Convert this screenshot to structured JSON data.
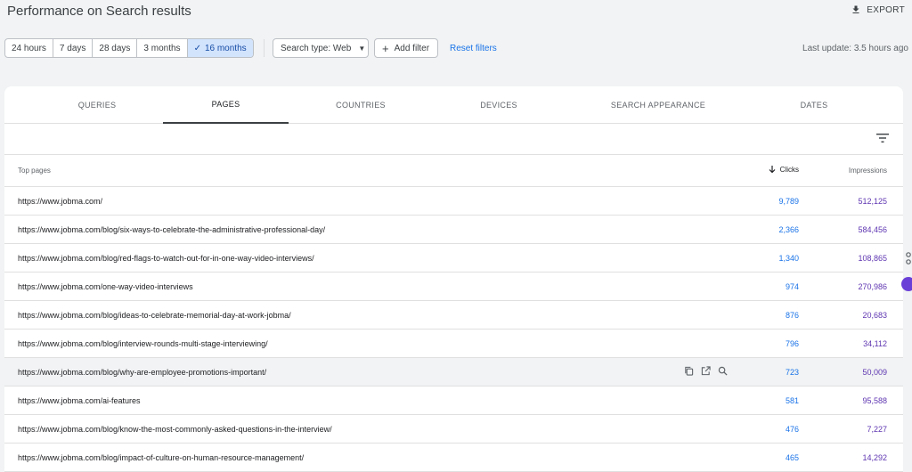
{
  "header": {
    "title": "Performance on Search results",
    "export_label": "EXPORT"
  },
  "date_ranges": [
    {
      "label": "24 hours",
      "active": false
    },
    {
      "label": "7 days",
      "active": false
    },
    {
      "label": "28 days",
      "active": false
    },
    {
      "label": "3 months",
      "active": false
    },
    {
      "label": "16 months",
      "active": true
    }
  ],
  "filters": {
    "search_type_label": "Search type: Web",
    "add_filter_label": "Add filter",
    "reset_label": "Reset filters"
  },
  "last_update": "Last update: 3.5 hours ago",
  "tabs": [
    "QUERIES",
    "PAGES",
    "COUNTRIES",
    "DEVICES",
    "SEARCH APPEARANCE",
    "DATES"
  ],
  "active_tab": "PAGES",
  "table": {
    "headers": {
      "pages": "Top pages",
      "clicks": "Clicks",
      "impressions": "Impressions"
    },
    "rows": [
      {
        "url": "https://www.jobma.com/",
        "clicks": "9,789",
        "impressions": "512,125"
      },
      {
        "url": "https://www.jobma.com/blog/six-ways-to-celebrate-the-administrative-professional-day/",
        "clicks": "2,366",
        "impressions": "584,456"
      },
      {
        "url": "https://www.jobma.com/blog/red-flags-to-watch-out-for-in-one-way-video-interviews/",
        "clicks": "1,340",
        "impressions": "108,865"
      },
      {
        "url": "https://www.jobma.com/one-way-video-interviews",
        "clicks": "974",
        "impressions": "270,986"
      },
      {
        "url": "https://www.jobma.com/blog/ideas-to-celebrate-memorial-day-at-work-jobma/",
        "clicks": "876",
        "impressions": "20,683"
      },
      {
        "url": "https://www.jobma.com/blog/interview-rounds-multi-stage-interviewing/",
        "clicks": "796",
        "impressions": "34,112"
      },
      {
        "url": "https://www.jobma.com/blog/why-are-employee-promotions-important/",
        "clicks": "723",
        "impressions": "50,009"
      },
      {
        "url": "https://www.jobma.com/ai-features",
        "clicks": "581",
        "impressions": "95,588"
      },
      {
        "url": "https://www.jobma.com/blog/know-the-most-commonly-asked-questions-in-the-interview/",
        "clicks": "476",
        "impressions": "7,227"
      },
      {
        "url": "https://www.jobma.com/blog/impact-of-culture-on-human-resource-management/",
        "clicks": "465",
        "impressions": "14,292"
      }
    ]
  },
  "colors": {
    "clicks": "#1a73e8",
    "impressions": "#5e35b1",
    "active_range": "#d2e3fc"
  },
  "icons": [
    "download-icon",
    "check-icon",
    "dropdown-arrow-icon",
    "plus-icon",
    "filter-icon",
    "sort-down-arrow-icon",
    "copy-icon",
    "open-in-new-icon",
    "magnifier-icon"
  ]
}
